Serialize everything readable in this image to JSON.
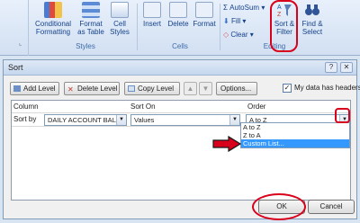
{
  "ribbon": {
    "styles": {
      "conditional_formatting": "Conditional\nFormatting",
      "format_as_table": "Format\nas Table",
      "cell_styles": "Cell\nStyles",
      "group_label": "Styles"
    },
    "cells": {
      "insert": "Insert",
      "delete": "Delete",
      "format": "Format",
      "group_label": "Cells"
    },
    "editing": {
      "autosum": "AutoSum",
      "fill": "Fill",
      "clear": "Clear",
      "sort_filter": "Sort &\nFilter",
      "find_select": "Find &\nSelect",
      "group_label": "Editing"
    }
  },
  "dialog": {
    "title": "Sort",
    "toolbar": {
      "add_level": "Add Level",
      "delete_level": "Delete Level",
      "copy_level": "Copy Level",
      "options": "Options...",
      "my_data_headers": "My data has headers",
      "headers_checked": true
    },
    "columns": {
      "column": "Column",
      "sort_on": "Sort On",
      "order": "Order"
    },
    "row": {
      "label": "Sort by",
      "column_value": "DAILY ACCOUNT BALA",
      "sort_on_value": "Values",
      "order_value": "A to Z"
    },
    "order_options": [
      "A to Z",
      "Z to A",
      "Custom List..."
    ],
    "selected_option_index": 2,
    "ok": "OK",
    "cancel": "Cancel"
  },
  "colors": {
    "highlight": "#d9001b",
    "selection": "#3399ff"
  }
}
